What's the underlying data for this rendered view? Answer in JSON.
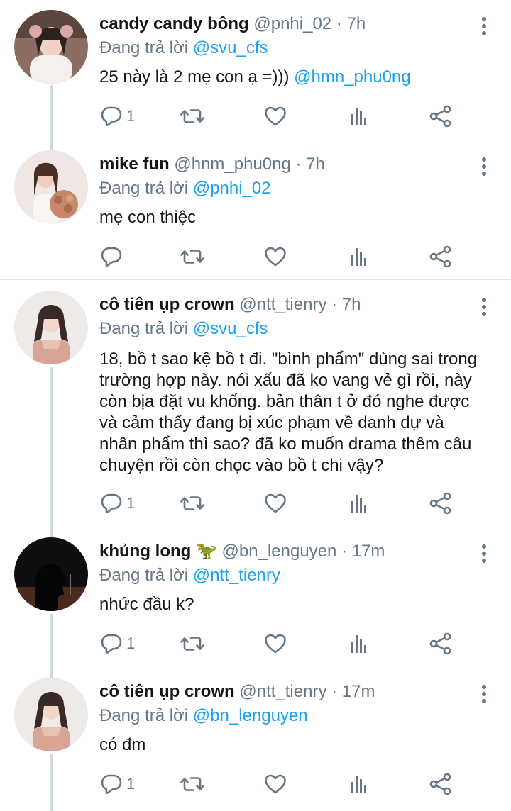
{
  "colors": {
    "link": "#1da1f2",
    "muted": "#657786",
    "text": "#14171a",
    "thread_line": "#cfd9de"
  },
  "tweets": [
    {
      "name": "candy candy bông",
      "handle": "@pnhi_02 · 7h",
      "reply_prefix": "Đang trả lời",
      "reply_to": "@svu_cfs",
      "text": "25 này là 2 mẹ con ạ =)))",
      "text_mention": "@hmn_phu0ng",
      "reply_count": "1"
    },
    {
      "name": "mike fun",
      "handle": "@hnm_phu0ng · 7h",
      "reply_prefix": "Đang trả lời",
      "reply_to": "@pnhi_02",
      "text": "mẹ con thiệc",
      "reply_count": ""
    },
    {
      "name": "cô tiên ụp crown",
      "handle": "@ntt_tienry · 7h",
      "reply_prefix": "Đang trả lời",
      "reply_to": "@svu_cfs",
      "text_lines": [
        "18, bồ t sao kệ bồ t đi. \"bình phẩm\" dùng sai trong",
        "trường hợp này. nói xấu đã ko vang vẻ gì rồi, này",
        "còn bịa đặt vu khống. bản thân t ở đó nghe được",
        "và cảm thấy đang bị xúc phạm về danh dự và",
        "nhân phẩm thì sao? đã ko muốn drama thêm câu",
        "chuyện rồi còn chọc vào bồ t chi vậy?"
      ],
      "reply_count": "1"
    },
    {
      "name": "khủng long",
      "name_emoji": "🦖",
      "handle": "@bn_lenguyen · 17m",
      "reply_prefix": "Đang trả lời",
      "reply_to": "@ntt_tienry",
      "text": "nhức đầu k?",
      "reply_count": "1"
    },
    {
      "name": "cô tiên ụp crown",
      "handle": "@ntt_tienry · 17m",
      "reply_prefix": "Đang trả lời",
      "reply_to": "@bn_lenguyen",
      "text": "có đm",
      "reply_count": "1"
    }
  ],
  "icons": [
    "reply-icon",
    "retweet-icon",
    "like-icon",
    "analytics-icon",
    "share-icon",
    "more-icon"
  ]
}
